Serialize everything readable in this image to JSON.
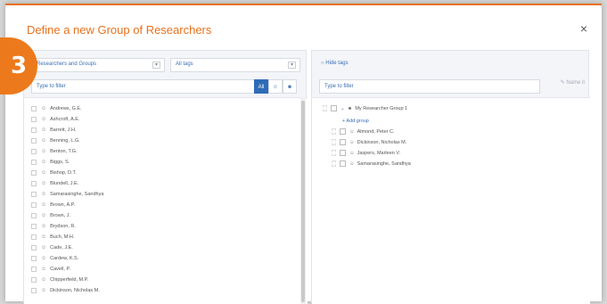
{
  "dialog": {
    "title": "Define a new Group of Researchers",
    "close_glyph": "×",
    "step_number": "3"
  },
  "left": {
    "researcher_select": "Researchers and Groups",
    "tags_select": "All tags",
    "filter_placeholder": "Type to filter",
    "seg_all": "All",
    "seg_person_icon": "person-icon",
    "seg_group_icon": "group-icon",
    "researchers": [
      "Andrews, G.E.",
      "Ashcroft, A.E.",
      "Barrett, J.H.",
      "Benning, L.G.",
      "Benton, T.G.",
      "Biggs, S.",
      "Bishop, D.T.",
      "Blundell, J.E.",
      "Samarasinghe, Sandhya",
      "Brown, A.P.",
      "Brown, J.",
      "Brydson, R.",
      "Buch, M.H.",
      "Cade, J.E.",
      "Cardew, K.S.",
      "Cavell, P.",
      "Chipperfield, M.P.",
      "Dickinson, Nicholas M."
    ]
  },
  "right": {
    "hide_tags": "Hide tags",
    "filter_placeholder": "Type to filter",
    "name_it": "Name it",
    "group_name": "My Researcher Group 1",
    "add_group": "+ Add group",
    "members": [
      "Almond, Peter C.",
      "Dickinson, Nicholas M.",
      "Jaspers, Marleen V.",
      "Samarasinghe, Sandhya"
    ]
  },
  "colors": {
    "accent": "#e9711c",
    "link": "#3a6fb3",
    "active_button": "#2e6cb7"
  }
}
